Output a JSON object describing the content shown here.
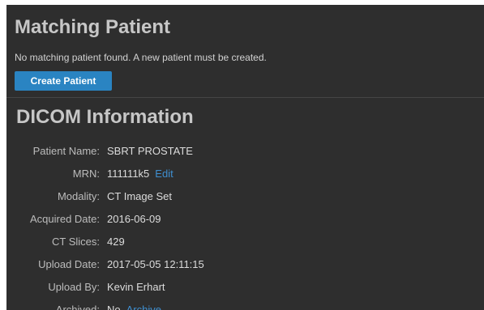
{
  "matching": {
    "heading": "Matching Patient",
    "message": "No matching patient found. A new patient must be created.",
    "create_button_label": "Create Patient"
  },
  "dicom": {
    "heading": "DICOM Information",
    "rows": [
      {
        "label": "Patient Name:",
        "value": "SBRT PROSTATE"
      },
      {
        "label": "MRN:",
        "value": "111111k5",
        "link": "Edit"
      },
      {
        "label": "Modality:",
        "value": "CT Image Set"
      },
      {
        "label": "Acquired Date:",
        "value": "2016-06-09"
      },
      {
        "label": "CT Slices:",
        "value": "429"
      },
      {
        "label": "Upload Date:",
        "value": "2017-05-05 12:11:15"
      },
      {
        "label": "Upload By:",
        "value": "Kevin Erhart"
      },
      {
        "label": "Archived:",
        "value": "No",
        "link": "Archive"
      }
    ]
  },
  "colors": {
    "panel_bg": "#2e2e2e",
    "heading": "#c7c7c7",
    "button_bg": "#2a84c2",
    "link": "#3f8fd0"
  }
}
